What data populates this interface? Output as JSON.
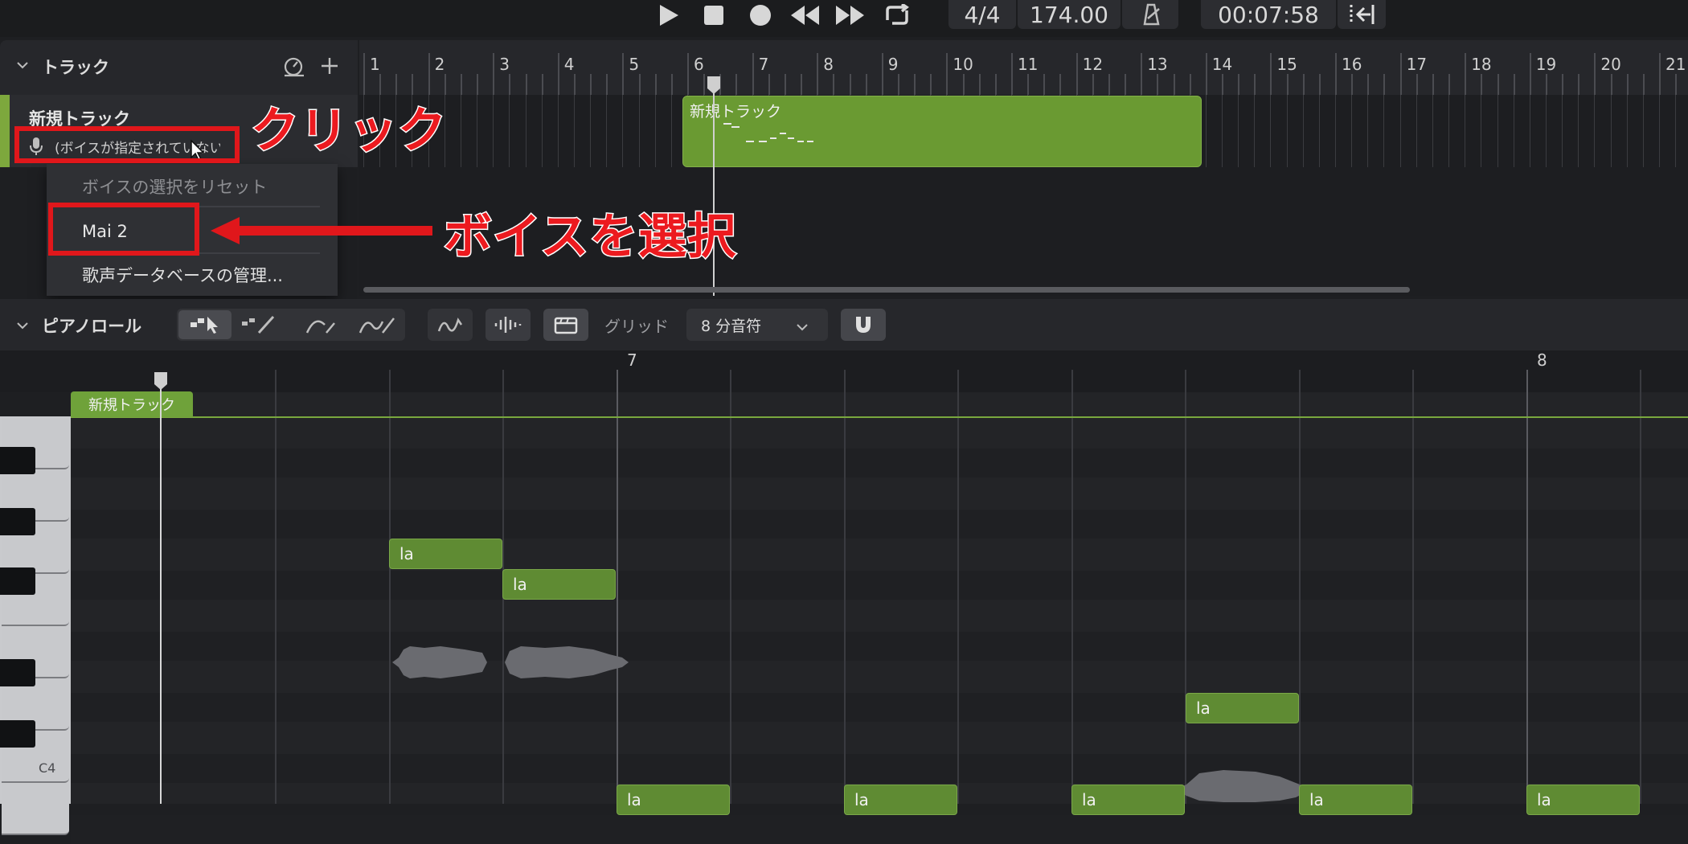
{
  "transport": {
    "time_signature": "4/4",
    "tempo": "174.00",
    "time": "00:07:58",
    "icons": [
      "play-icon",
      "stop-icon",
      "record-icon",
      "rewind-icon",
      "fast-forward-icon",
      "loop-icon",
      "metronome-icon",
      "jump-to-start-icon"
    ]
  },
  "tracks_panel": {
    "title": "トラック",
    "ruler": [
      "1",
      "2",
      "3",
      "4",
      "5",
      "6",
      "7",
      "8",
      "9",
      "10",
      "11",
      "12",
      "13",
      "14",
      "15",
      "16",
      "17",
      "18",
      "19",
      "20",
      "21"
    ],
    "track": {
      "name": "新規トラック",
      "voice": "(ボイスが指定されていない)...",
      "clip_label": "新規トラック"
    }
  },
  "voice_menu": {
    "items": [
      "ボイスの選択をリセット",
      "Mai 2",
      "歌声データベースの管理..."
    ]
  },
  "annotations": {
    "click": "クリック",
    "select_voice": "ボイスを選択"
  },
  "piano_roll": {
    "title": "ピアノロール",
    "grid_label": "グリッド",
    "grid_value": "8 分音符",
    "bars": [
      "7",
      "8"
    ],
    "group_label": "新規トラック",
    "key_label": "C4",
    "notes": [
      {
        "lyric": "la"
      },
      {
        "lyric": "la"
      },
      {
        "lyric": "la"
      },
      {
        "lyric": "la"
      },
      {
        "lyric": "la"
      },
      {
        "lyric": "la"
      },
      {
        "lyric": "la"
      },
      {
        "lyric": "la"
      }
    ]
  },
  "colors": {
    "accent_green": "#6a9a32",
    "annotation_red": "#e0171b",
    "background": "#1e1f22"
  }
}
